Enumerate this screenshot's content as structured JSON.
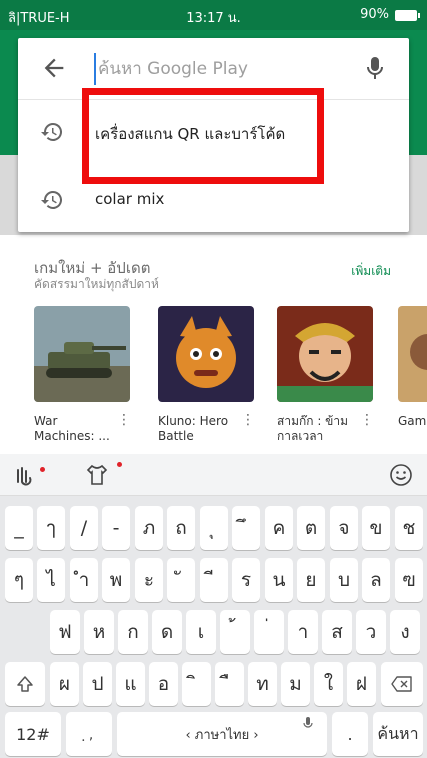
{
  "status_bar": {
    "carrier": "ลิ|TRUE-H",
    "time": "13:17 น.",
    "battery": "90%"
  },
  "search": {
    "placeholder": "ค้นหา Google Play",
    "value": "",
    "suggestions": [
      {
        "text": "เครื่องสแกน QR และบาร์โค้ด",
        "icon": "history-icon"
      },
      {
        "text": "colar mix",
        "icon": "history-icon"
      }
    ]
  },
  "section": {
    "title": "เกมใหม่ + อัปเดต",
    "subtitle": "คัดสรรมาใหม่ทุกสัปดาห์",
    "more": "เพิ่มเติม"
  },
  "apps": [
    {
      "name": "War Machines: ..."
    },
    {
      "name": "Kluno: Hero Battle"
    },
    {
      "name": "สามก๊ก : ข้ามกาลเวลา"
    },
    {
      "name": "Gam Sulta"
    }
  ],
  "keyboard": {
    "row1": [
      "_",
      "ๅ",
      "/",
      "-",
      "ภ",
      "ถ",
      "ุ",
      "ึ",
      "ค",
      "ต",
      "จ",
      "ข",
      "ช"
    ],
    "row2": [
      "ๆ",
      "ไ",
      "ำ",
      "พ",
      "ะ",
      "ั",
      "ี",
      "ร",
      "น",
      "ย",
      "บ",
      "ล",
      "ฃ"
    ],
    "row3": [
      "ฟ",
      "ห",
      "ก",
      "ด",
      "เ",
      "้",
      "่",
      "า",
      "ส",
      "ว",
      "ง"
    ],
    "row4": [
      "ผ",
      "ป",
      "แ",
      "อ",
      "ิ",
      "ื",
      "ท",
      "ม",
      "ใ",
      "ฝ"
    ],
    "shift_icon": "shift-icon",
    "backspace_icon": "backspace-icon",
    "mode_key": "12#",
    "punct_key": "ฺ ,",
    "space_label": "‹ ภาษาไทย ›",
    "period_key": ".",
    "enter_key": "ค้นหา"
  }
}
